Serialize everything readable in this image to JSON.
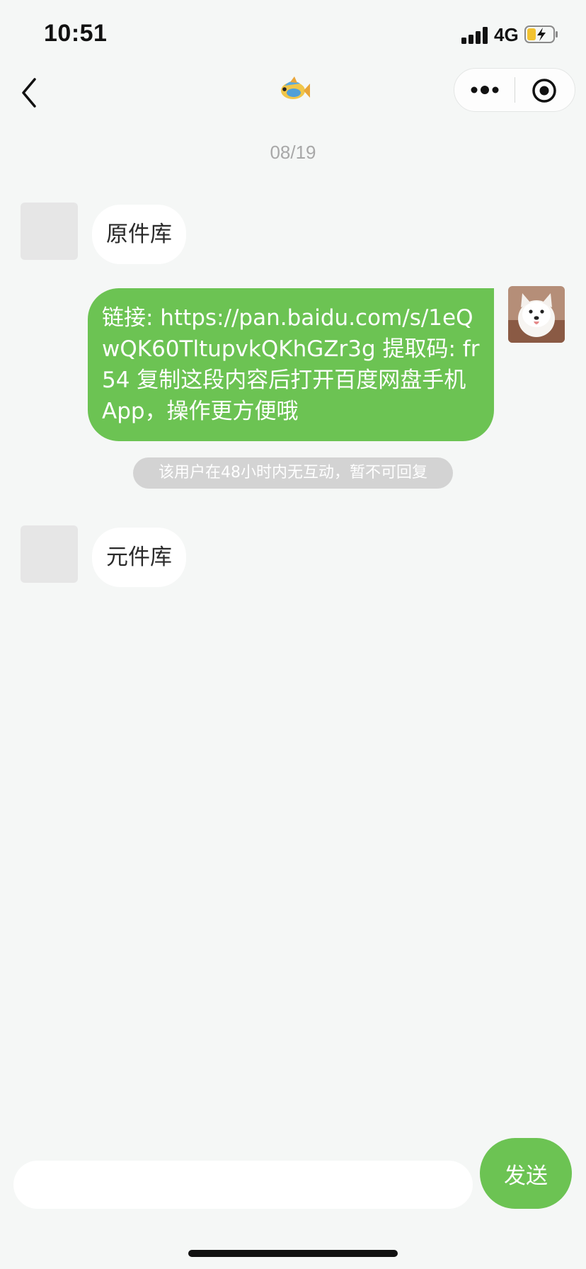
{
  "status_bar": {
    "time": "10:51",
    "network": "4G",
    "battery_level": 0.35
  },
  "nav": {
    "title_icon": "tropical-fish-emoji",
    "back_icon": "chevron-left-icon",
    "more_icon": "more-dots-icon",
    "close_icon": "record-circle-icon"
  },
  "date_stamp": "08/19",
  "messages": [
    {
      "side": "left",
      "text": "原件库"
    },
    {
      "side": "right",
      "text": "链接: https://pan.baidu.com/s/1eQwQK60TltupvkQKhGZr3g 提取码: fr54 复制这段内容后打开百度网盘手机App，操作更方便哦"
    },
    {
      "side": "left",
      "text": "元件库"
    }
  ],
  "system_notice": "该用户在48小时内无互动，暂不可回复",
  "composer": {
    "value": "",
    "send_label": "发送"
  },
  "colors": {
    "accent_green": "#6cc353",
    "background": "#f5f7f6",
    "notice_gray": "#d3d3d3"
  }
}
